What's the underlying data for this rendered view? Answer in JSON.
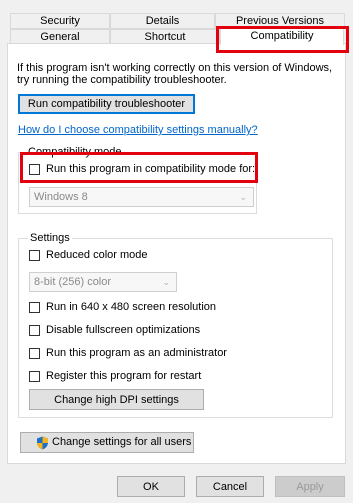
{
  "tabs_row1": [
    "Security",
    "Details",
    "Previous Versions"
  ],
  "tabs_row2": [
    "General",
    "Shortcut",
    "Compatibility"
  ],
  "intro_text_line1": "If this program isn't working correctly on this version of Windows,",
  "intro_text_line2": "try running the compatibility troubleshooter.",
  "troubleshooter_button": "Run compatibility troubleshooter",
  "manual_link": "How do I choose compatibility settings manually?",
  "compat_mode": {
    "group_title": "Compatibility mode",
    "checkbox_label": "Run this program in compatibility mode for:",
    "checked": false,
    "os_selected": "Windows 8"
  },
  "settings": {
    "group_title": "Settings",
    "reduced_color_label": "Reduced color mode",
    "color_selected": "8-bit (256) color",
    "res_label": "Run in 640 x 480 screen resolution",
    "fullscreen_label": "Disable fullscreen optimizations",
    "admin_label": "Run this program as an administrator",
    "restart_label": "Register this program for restart",
    "dpi_button": "Change high DPI settings"
  },
  "all_users_button": "Change settings for all users",
  "footer": {
    "ok": "OK",
    "cancel": "Cancel",
    "apply": "Apply"
  },
  "colors": {
    "highlight_red": "#e3000f",
    "link_blue": "#0066cc",
    "focus_blue": "#0078d7"
  }
}
